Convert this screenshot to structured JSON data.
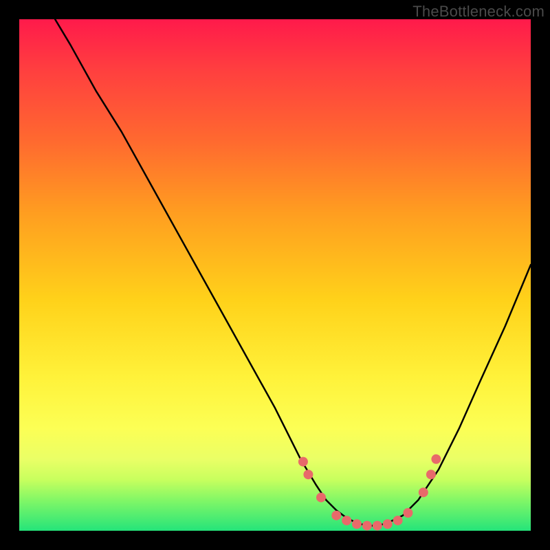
{
  "watermark": "TheBottleneck.com",
  "colors": {
    "background": "#000000",
    "gradient_top": "#ff1a4b",
    "gradient_bottom": "#25e47a",
    "curve": "#000000",
    "dot": "#e86a6a"
  },
  "chart_data": {
    "type": "line",
    "title": "",
    "xlabel": "",
    "ylabel": "",
    "xlim": [
      0,
      100
    ],
    "ylim": [
      0,
      100
    ],
    "series": [
      {
        "name": "bottleneck-curve",
        "x": [
          7,
          10,
          15,
          20,
          25,
          30,
          35,
          40,
          45,
          50,
          55,
          58,
          60,
          62,
          64,
          66,
          68,
          70,
          72,
          75,
          78,
          82,
          86,
          90,
          95,
          100
        ],
        "y": [
          100,
          95,
          86,
          78,
          69,
          60,
          51,
          42,
          33,
          24,
          14,
          9,
          6,
          4,
          2.5,
          1.5,
          1,
          1,
          1.5,
          3,
          6,
          12,
          20,
          29,
          40,
          52
        ]
      }
    ],
    "markers": {
      "name": "highlight-dots",
      "x": [
        55.5,
        56.5,
        59,
        62,
        64,
        66,
        68,
        70,
        72,
        74,
        76,
        79,
        80.5,
        81.5
      ],
      "y": [
        13.5,
        11,
        6.5,
        3,
        2,
        1.3,
        1,
        1,
        1.3,
        2,
        3.5,
        7.5,
        11,
        14
      ]
    }
  }
}
